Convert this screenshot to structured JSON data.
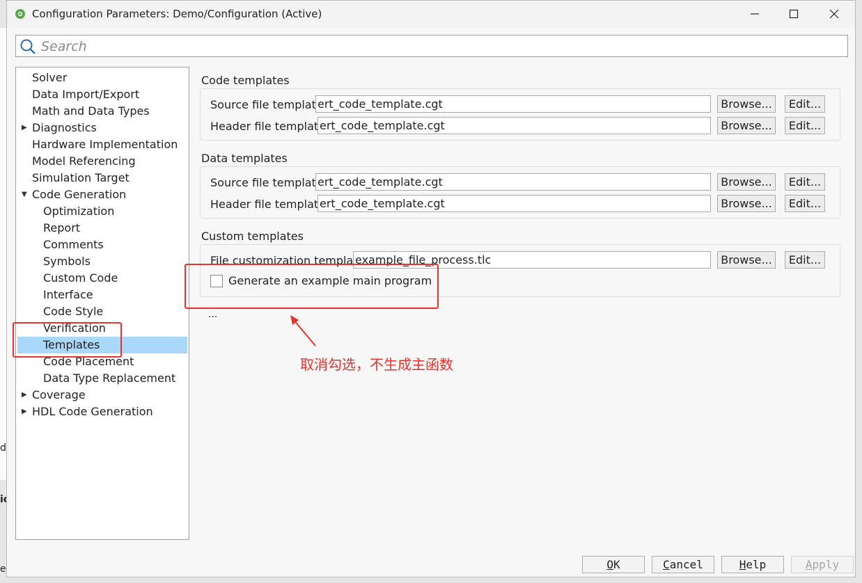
{
  "window": {
    "title": "Configuration Parameters: Demo/Configuration (Active)"
  },
  "search": {
    "placeholder": "Search"
  },
  "tree": {
    "items": [
      {
        "label": "Solver"
      },
      {
        "label": "Data Import/Export"
      },
      {
        "label": "Math and Data Types"
      },
      {
        "label": "Diagnostics",
        "expander": "collapsed"
      },
      {
        "label": "Hardware Implementation"
      },
      {
        "label": "Model Referencing"
      },
      {
        "label": "Simulation Target"
      },
      {
        "label": "Code Generation",
        "expander": "expanded"
      },
      {
        "label": "Optimization"
      },
      {
        "label": "Report"
      },
      {
        "label": "Comments"
      },
      {
        "label": "Symbols"
      },
      {
        "label": "Custom Code"
      },
      {
        "label": "Interface"
      },
      {
        "label": "Code Style"
      },
      {
        "label": "Verification"
      },
      {
        "label": "Templates",
        "selected": true
      },
      {
        "label": "Code Placement"
      },
      {
        "label": "Data Type Replacement"
      },
      {
        "label": "Coverage",
        "expander": "collapsed"
      },
      {
        "label": "HDL Code Generation",
        "expander": "collapsed"
      }
    ]
  },
  "code_templates": {
    "title": "Code templates",
    "source_label": "Source file template:",
    "source_value": "ert_code_template.cgt",
    "header_label": "Header file template:",
    "header_value": "ert_code_template.cgt"
  },
  "data_templates": {
    "title": "Data templates",
    "source_label": "Source file template:",
    "source_value": "ert_code_template.cgt",
    "header_label": "Header file template:",
    "header_value": "ert_code_template.cgt"
  },
  "custom_templates": {
    "title": "Custom templates",
    "file_label": "File customization template:",
    "file_value": "example_file_process.tlc",
    "checkbox_label": "Generate an example main program",
    "checkbox_checked": false
  },
  "buttons": {
    "browse": "Browse...",
    "edit": "Edit..."
  },
  "ellipsis": "...",
  "annotation": {
    "text": "取消勾选，不生成主函数",
    "color": "#e8322b"
  },
  "footer": {
    "ok": {
      "u": "O",
      "rest": "K"
    },
    "cancel": {
      "u": "C",
      "rest": "ancel"
    },
    "help": {
      "u": "H",
      "rest": "elp"
    },
    "apply": {
      "u": "A",
      "rest": "pply"
    }
  },
  "background_fragments": {
    "d": "d",
    "ic": "ic",
    "e": "e"
  }
}
